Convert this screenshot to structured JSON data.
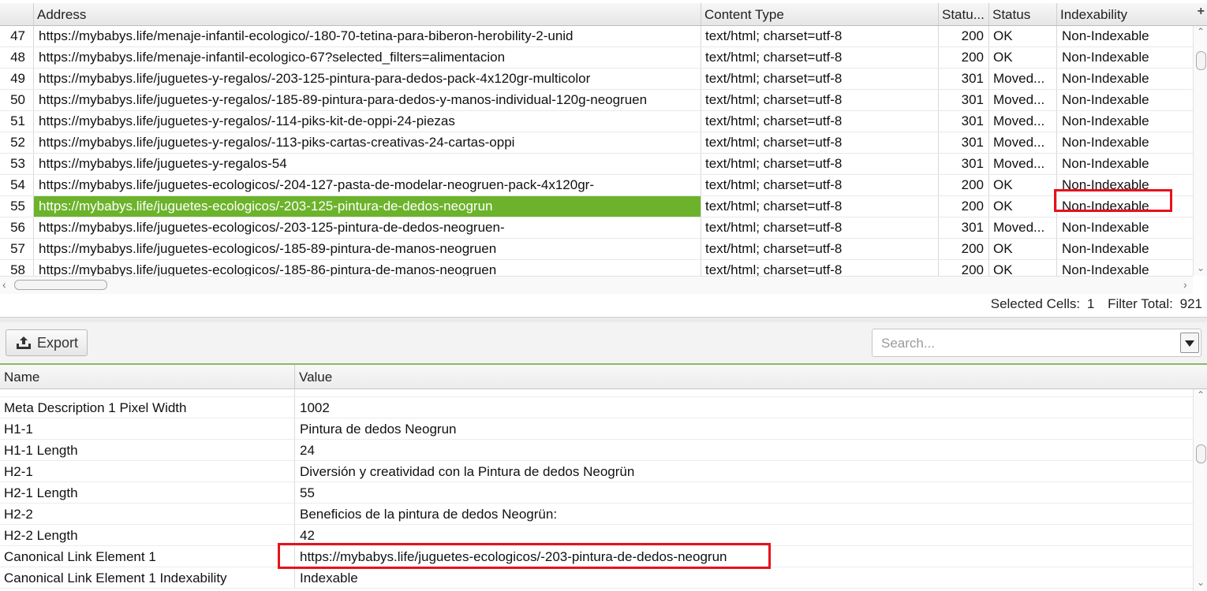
{
  "grid": {
    "columns": [
      "Address",
      "Content Type",
      "Statu...",
      "Status",
      "Indexability"
    ],
    "add_column_label": "+",
    "rows": [
      {
        "num": "47",
        "address": "https://mybabys.life/menaje-infantil-ecologico/-180-70-tetina-para-biberon-herobility-2-unid",
        "content_type": "text/html; charset=utf-8",
        "status_code": "200",
        "status": "OK",
        "indexability": "Non-Indexable"
      },
      {
        "num": "48",
        "address": "https://mybabys.life/menaje-infantil-ecologico-67?selected_filters=alimentacion",
        "content_type": "text/html; charset=utf-8",
        "status_code": "200",
        "status": "OK",
        "indexability": "Non-Indexable"
      },
      {
        "num": "49",
        "address": "https://mybabys.life/juguetes-y-regalos/-203-125-pintura-para-dedos-pack-4x120gr-multicolor",
        "content_type": "text/html; charset=utf-8",
        "status_code": "301",
        "status": "Moved...",
        "indexability": "Non-Indexable"
      },
      {
        "num": "50",
        "address": "https://mybabys.life/juguetes-y-regalos/-185-89-pintura-para-dedos-y-manos-individual-120g-neogruen",
        "content_type": "text/html; charset=utf-8",
        "status_code": "301",
        "status": "Moved...",
        "indexability": "Non-Indexable"
      },
      {
        "num": "51",
        "address": "https://mybabys.life/juguetes-y-regalos/-114-piks-kit-de-oppi-24-piezas",
        "content_type": "text/html; charset=utf-8",
        "status_code": "301",
        "status": "Moved...",
        "indexability": "Non-Indexable"
      },
      {
        "num": "52",
        "address": "https://mybabys.life/juguetes-y-regalos/-113-piks-cartas-creativas-24-cartas-oppi",
        "content_type": "text/html; charset=utf-8",
        "status_code": "301",
        "status": "Moved...",
        "indexability": "Non-Indexable"
      },
      {
        "num": "53",
        "address": "https://mybabys.life/juguetes-y-regalos-54",
        "content_type": "text/html; charset=utf-8",
        "status_code": "301",
        "status": "Moved...",
        "indexability": "Non-Indexable"
      },
      {
        "num": "54",
        "address": "https://mybabys.life/juguetes-ecologicos/-204-127-pasta-de-modelar-neogruen-pack-4x120gr-",
        "content_type": "text/html; charset=utf-8",
        "status_code": "200",
        "status": "OK",
        "indexability": "Non-Indexable"
      },
      {
        "num": "55",
        "address": "https://mybabys.life/juguetes-ecologicos/-203-125-pintura-de-dedos-neogrun",
        "content_type": "text/html; charset=utf-8",
        "status_code": "200",
        "status": "OK",
        "indexability": "Non-Indexable",
        "selected": true
      },
      {
        "num": "56",
        "address": "https://mybabys.life/juguetes-ecologicos/-203-125-pintura-de-dedos-neogruen-",
        "content_type": "text/html; charset=utf-8",
        "status_code": "301",
        "status": "Moved...",
        "indexability": "Non-Indexable"
      },
      {
        "num": "57",
        "address": "https://mybabys.life/juguetes-ecologicos/-185-89-pintura-de-manos-neogruen",
        "content_type": "text/html; charset=utf-8",
        "status_code": "200",
        "status": "OK",
        "indexability": "Non-Indexable"
      },
      {
        "num": "58",
        "address": "https://mybabys.life/juguetes-ecologicos/-185-86-pintura-de-manos-neogruen",
        "content_type": "text/html; charset=utf-8",
        "status_code": "200",
        "status": "OK",
        "indexability": "Non-Indexable"
      }
    ]
  },
  "status_bar": {
    "selected_cells_label": "Selected Cells:",
    "selected_cells_value": "1",
    "filter_total_label": "Filter Total:",
    "filter_total_value": "921"
  },
  "toolbar": {
    "export_label": "Export",
    "export_icon": "upload-tray-icon",
    "search_placeholder": "Search...",
    "search_value": ""
  },
  "details": {
    "columns": [
      "Name",
      "Value"
    ],
    "rows": [
      {
        "name": "Meta Description 1 Pixel Width",
        "value": "1002"
      },
      {
        "name": "H1-1",
        "value": "Pintura de dedos Neogrun"
      },
      {
        "name": "H1-1 Length",
        "value": "24"
      },
      {
        "name": "H2-1",
        "value": "Diversión y creatividad con la Pintura de dedos Neogrün"
      },
      {
        "name": "H2-1 Length",
        "value": "55"
      },
      {
        "name": "H2-2",
        "value": "Beneficios de la pintura de dedos Neogrün:"
      },
      {
        "name": "H2-2 Length",
        "value": "42"
      },
      {
        "name": "Canonical Link Element 1",
        "value": "https://mybabys.life/juguetes-ecologicos/-203-pintura-de-dedos-neogrun"
      },
      {
        "name": "Canonical Link Element 1 Indexability",
        "value": "Indexable"
      }
    ]
  },
  "colors": {
    "selection": "#6cb32b",
    "highlight_box": "#e8111b",
    "toolbar_accent": "#8ab86a"
  }
}
